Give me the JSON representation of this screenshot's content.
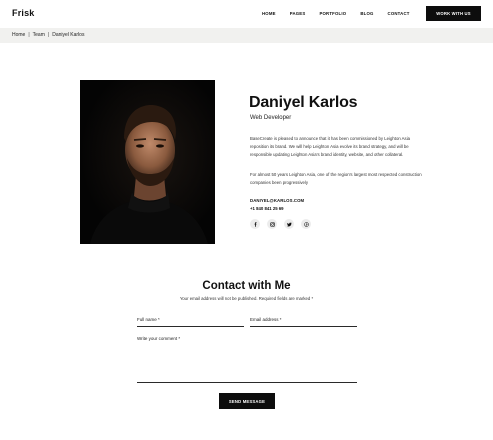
{
  "header": {
    "logo": "Frisk",
    "nav": [
      "HOME",
      "PAGES",
      "PORTFOLIO",
      "BLOG",
      "CONTACT"
    ],
    "cta": "WORK WITH US"
  },
  "breadcrumb": [
    "Home",
    "Team",
    "Daniyel Karlos"
  ],
  "breadcrumb_separator": "|",
  "profile": {
    "name": "Daniyel Karlos",
    "role": "Web Developer",
    "paragraph1": "BaseCreate is pleased to announce that it has been commissioned by Leighton Asia reposition its brand. We will help Leighton Asia evolve its brand strategy, and will be responsible updating Leighton Asia's brand identity, website, and other collateral.",
    "paragraph2": "For almost 50 years Leighton Asia, one of the region's largest most respected construction companies been progressively",
    "email": "DANIYEL@KARLOS.COM",
    "phone": "+1 840 841 25 69",
    "socials": [
      "facebook-icon",
      "instagram-icon",
      "twitter-icon",
      "pinterest-icon"
    ]
  },
  "contact": {
    "title": "Contact with Me",
    "subtitle": "Your email address will not be published. Required fields are marked *",
    "first_name_label": "Full name *",
    "email_label": "Email address *",
    "comment_label": "Write your comment *",
    "submit": "SEND MESSAGE"
  },
  "colors": {
    "accent": "#0d0d0d",
    "breadcrumb_bg": "#f1f1ef",
    "photo_bg": "#050505"
  }
}
